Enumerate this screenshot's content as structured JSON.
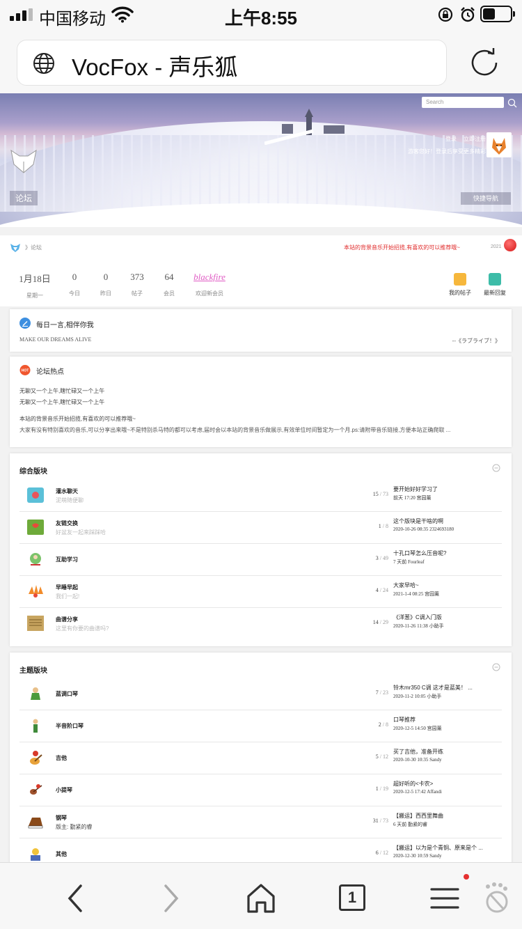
{
  "status_bar": {
    "carrier": "中国移动",
    "time": "上午8:55",
    "battery_level": 0.45
  },
  "browser": {
    "page_title": "VocFox - 声乐狐",
    "tabs_count": "1"
  },
  "banner": {
    "search_placeholder": "Search",
    "login": "登录",
    "register": "立即注册",
    "login_tip": "游客您好！登录后享受更多精彩",
    "forum_label": "论坛",
    "quick_nav": "快捷导航"
  },
  "breadcrumb": {
    "path": "》论坛",
    "notice": "本站的背景音乐开始招揽,有喜欢的可以推荐哦~",
    "year": "2021"
  },
  "stats": [
    {
      "value": "1月18日",
      "label": "星期一"
    },
    {
      "value": "0",
      "label": "今日"
    },
    {
      "value": "0",
      "label": "昨日"
    },
    {
      "value": "373",
      "label": "帖子"
    },
    {
      "value": "64",
      "label": "会员"
    },
    {
      "value": "blackfire",
      "label": "欢迎新会员"
    }
  ],
  "quick_buttons": {
    "my_posts": "我的帖子",
    "latest_replies": "最新回复"
  },
  "daily": {
    "title": "每日一言,相伴你我",
    "quote": "MAKE OUR DREAMS ALIVE",
    "source": "--《ラブライブ！》"
  },
  "hot": {
    "title": "论坛热点",
    "line1": "无聊又一个上午,瞎忙碌又一个上午",
    "line2": "无聊又一个上午,瞎忙碌又一个上午",
    "line3": "本站的背景音乐开始招揽,有喜欢的可以推荐哦~",
    "line4": "大家有没有特别喜欢的音乐,可以分享出来哦~不是特别杀马特的都可以考虑,届时会以本站的背景音乐做展示,有效单位时间暂定为一个月.ps:请附带音乐链接,方便本站正确爬取 ..."
  },
  "section_general": {
    "title": "综合版块",
    "rows": [
      {
        "name": "灌水聊天",
        "desc": "泥萌随便聊",
        "threads": "15",
        "posts": "73",
        "last_title": "要开始好好学习了",
        "last_meta": "前天 17:20 宫园薰"
      },
      {
        "name": "友链交换",
        "desc": "好盆友一起来踩踩哈",
        "threads": "1",
        "posts": "8",
        "last_title": "这个版块是干啥的啊",
        "last_meta": "2020-10-26 08:35 2324693180"
      },
      {
        "name": "互助学习",
        "desc": "",
        "threads": "3",
        "posts": "49",
        "last_title": "十孔口琴怎么压音呢?",
        "last_meta": "7 天前 Fourleaf"
      },
      {
        "name": "早睡早起",
        "desc": "我们一起!",
        "threads": "4",
        "posts": "24",
        "last_title": "大家早哈~",
        "last_meta": "2021-1-4 08:25 宫园薰"
      },
      {
        "name": "曲谱分享",
        "desc": "这里有你要的曲谱吗?",
        "threads": "14",
        "posts": "29",
        "last_title": "《洋葱》C调入门版",
        "last_meta": "2020-11-26 11:38 小助手"
      }
    ]
  },
  "section_topic": {
    "title": "主题版块",
    "rows": [
      {
        "name": "蓝调口琴",
        "desc": "",
        "threads": "7",
        "posts": "23",
        "last_title": "铃木mr350 C调 这才是蓝美！ ...",
        "last_meta": "2020-11-2 10:05 小助手"
      },
      {
        "name": "半音阶口琴",
        "desc": "",
        "threads": "2",
        "posts": "8",
        "last_title": "口琴推荐",
        "last_meta": "2020-12-5 14:50 宫园薰"
      },
      {
        "name": "吉他",
        "desc": "",
        "threads": "5",
        "posts": "12",
        "last_title": "买了吉他，准备开练",
        "last_meta": "2020-10-30 10:35 Sandy"
      },
      {
        "name": "小提琴",
        "desc": "",
        "threads": "1",
        "posts": "19",
        "last_title": "超好听的<卡农>",
        "last_meta": "2020-12-5 17:42 Affandi"
      },
      {
        "name": "钢琴",
        "desc": "版主: 勤紧的睿",
        "threads": "31",
        "posts": "73",
        "last_title": "【搬运】西西里舞曲",
        "last_meta": "6 天前 勤紧的睿"
      },
      {
        "name": "其他",
        "desc": "",
        "threads": "6",
        "posts": "12",
        "last_title": "【搬运】以为是个青铜、原来是个 ...",
        "last_meta": "2020-12-30 10:59 Sandy"
      }
    ]
  }
}
